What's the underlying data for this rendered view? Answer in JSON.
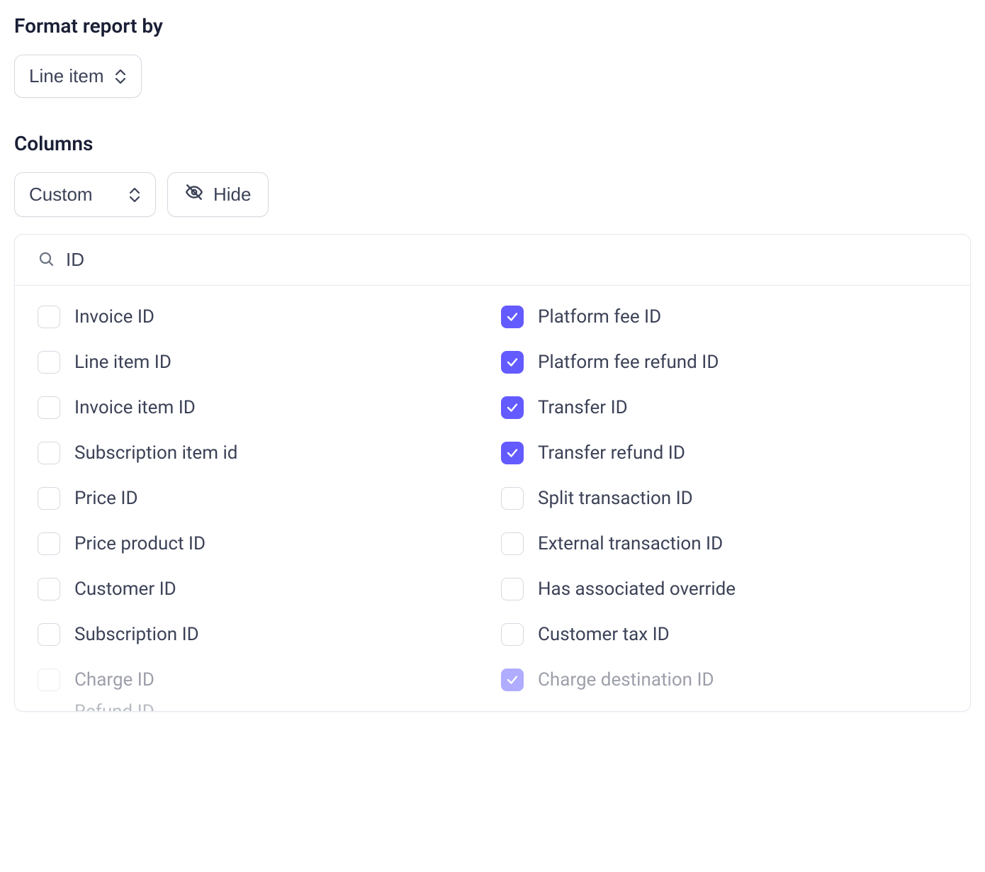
{
  "format_section": {
    "label": "Format report by",
    "select_value": "Line item"
  },
  "columns_section": {
    "label": "Columns",
    "select_value": "Custom",
    "hide_label": "Hide",
    "search_value": "ID",
    "left_options": [
      {
        "label": "Invoice ID",
        "checked": false,
        "faded": false
      },
      {
        "label": "Line item ID",
        "checked": false,
        "faded": false
      },
      {
        "label": "Invoice item ID",
        "checked": false,
        "faded": false
      },
      {
        "label": "Subscription item id",
        "checked": false,
        "faded": false
      },
      {
        "label": "Price ID",
        "checked": false,
        "faded": false
      },
      {
        "label": "Price product ID",
        "checked": false,
        "faded": false
      },
      {
        "label": "Customer ID",
        "checked": false,
        "faded": false
      },
      {
        "label": "Subscription ID",
        "checked": false,
        "faded": false
      },
      {
        "label": "Charge ID",
        "checked": false,
        "faded": true
      }
    ],
    "right_options": [
      {
        "label": "Platform fee ID",
        "checked": true,
        "faded": false
      },
      {
        "label": "Platform fee refund ID",
        "checked": true,
        "faded": false
      },
      {
        "label": "Transfer ID",
        "checked": true,
        "faded": false
      },
      {
        "label": "Transfer refund ID",
        "checked": true,
        "faded": false
      },
      {
        "label": "Split transaction ID",
        "checked": false,
        "faded": false
      },
      {
        "label": "External transaction ID",
        "checked": false,
        "faded": false
      },
      {
        "label": "Has associated override",
        "checked": false,
        "faded": false
      },
      {
        "label": "Customer tax ID",
        "checked": false,
        "faded": false
      },
      {
        "label": "Charge destination ID",
        "checked": true,
        "faded": true
      }
    ],
    "truncated_hint": "Refund ID"
  }
}
